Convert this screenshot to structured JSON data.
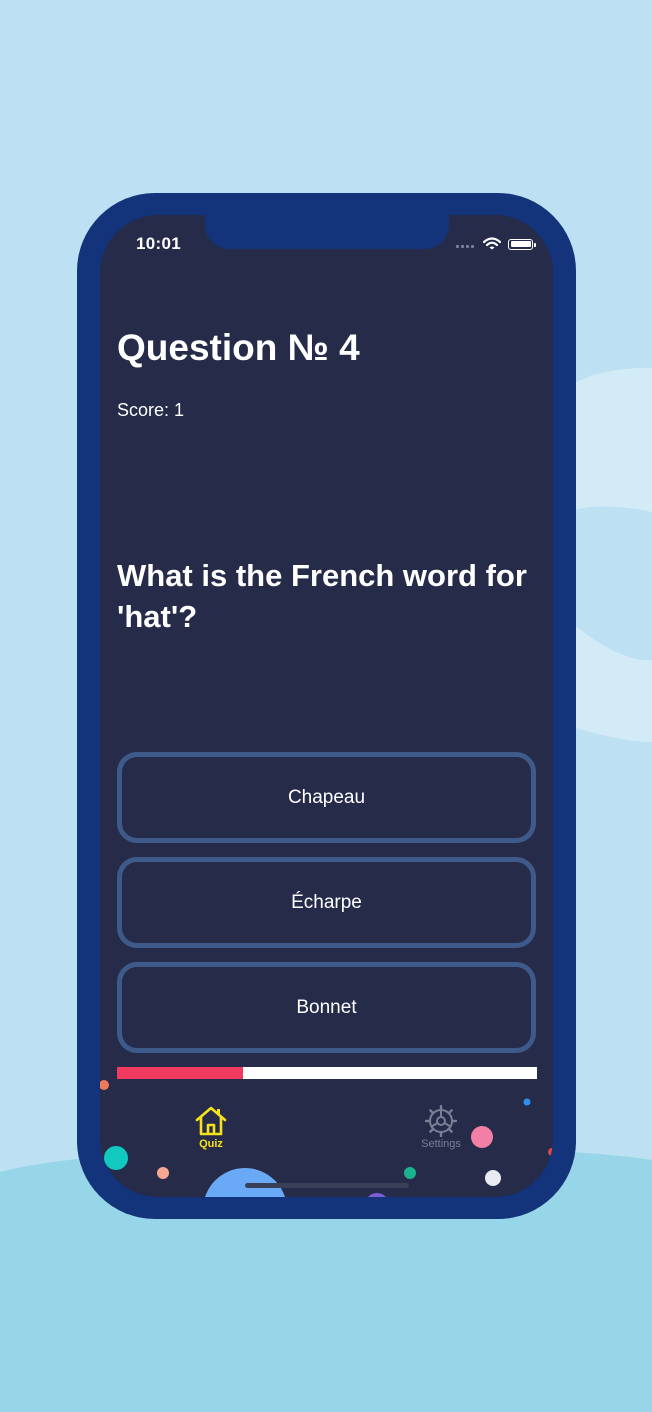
{
  "status_bar": {
    "time": "10:01"
  },
  "quiz": {
    "question_number": "Question № 4",
    "score": "Score: 1",
    "question": "What is the French word for 'hat'?",
    "answers": [
      "Chapeau",
      "Écharpe",
      "Bonnet"
    ],
    "progress": 0.3
  },
  "tab_bar": {
    "quiz_label": "Quiz",
    "settings_label": "Settings",
    "active_tab": "Quiz"
  },
  "icons": {
    "quiz_tab": "home-icon",
    "settings_tab": "gear-icon",
    "wifi": "wifi-icon",
    "battery": "battery-icon"
  },
  "colors": {
    "background": "#bde0f2",
    "phone_frame": "#13347a",
    "screen": "#252b48",
    "answer_border": "#3e5a8a",
    "progress_fill": "#f03a5f",
    "progress_track": "#ffffff",
    "active_tab": "#f5e21a",
    "inactive_tab": "#7a7f96"
  }
}
